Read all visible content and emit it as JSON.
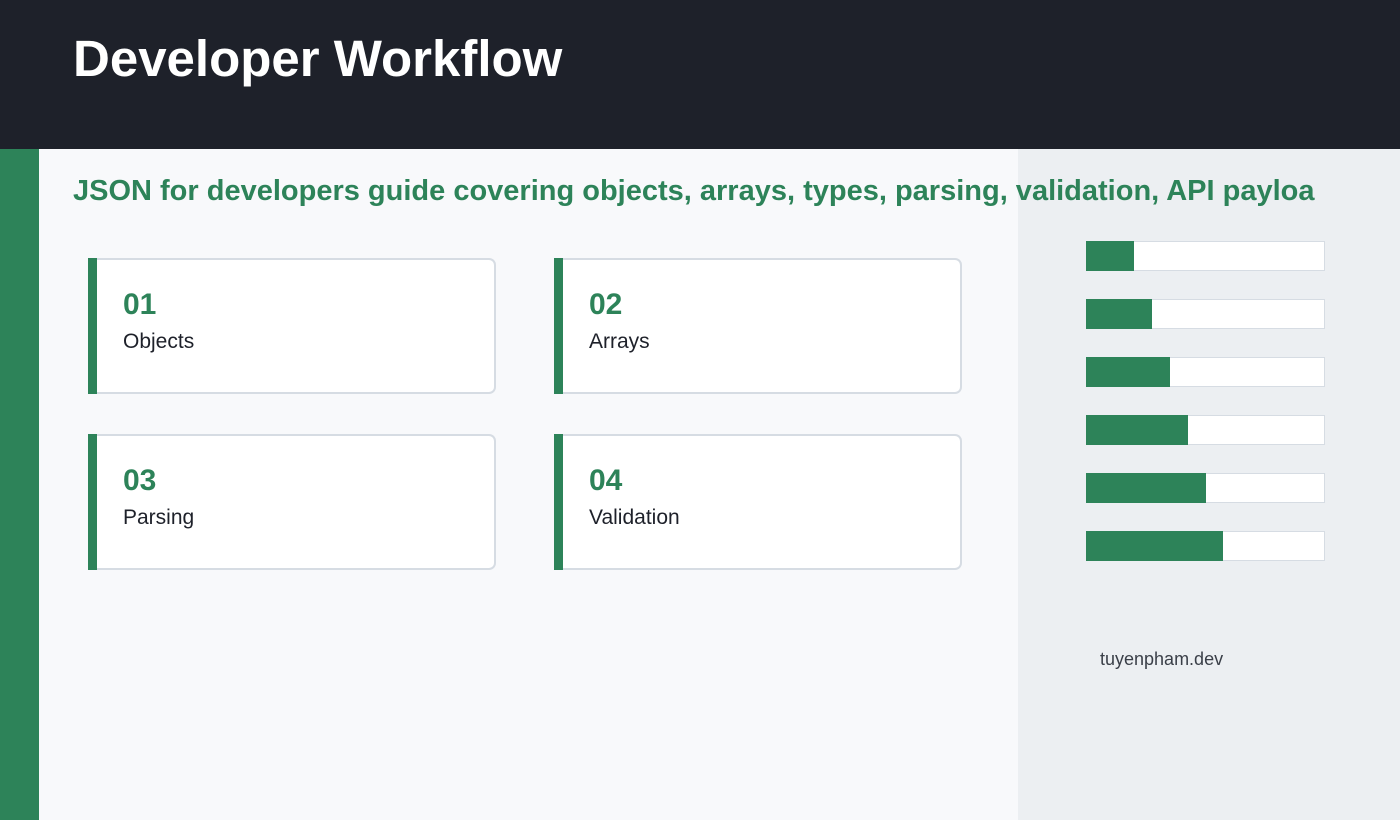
{
  "header": {
    "title": "Developer Workflow"
  },
  "subtitle": "JSON for developers guide covering objects, arrays, types, parsing, validation, API payloa",
  "cards": [
    {
      "number": "01",
      "label": "Objects"
    },
    {
      "number": "02",
      "label": "Arrays"
    },
    {
      "number": "03",
      "label": "Parsing"
    },
    {
      "number": "04",
      "label": "Validation"
    }
  ],
  "progress_bars": [
    {
      "fill_fraction": 0.2
    },
    {
      "fill_fraction": 0.275
    },
    {
      "fill_fraction": 0.35
    },
    {
      "fill_fraction": 0.425
    },
    {
      "fill_fraction": 0.5
    },
    {
      "fill_fraction": 0.575
    }
  ],
  "footer": {
    "url": "tuyenpham.dev"
  },
  "colors": {
    "accent": "#2d8359",
    "header_bg": "#1e212a",
    "side_panel_bg": "#eceff2"
  }
}
